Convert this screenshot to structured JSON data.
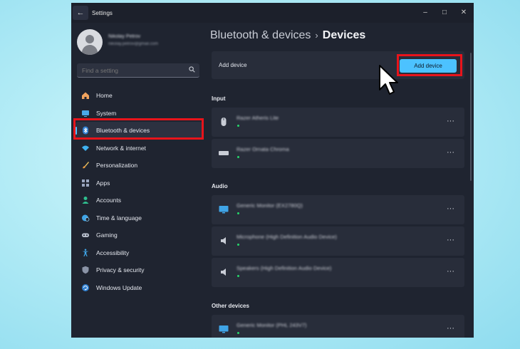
{
  "window": {
    "title": "Settings",
    "controls": {
      "minimize": "–",
      "maximize": "□",
      "close": "✕"
    }
  },
  "profile": {
    "name": "Nikolay Petrov",
    "email": "nikolay.petrov@gmail.com"
  },
  "search": {
    "placeholder": "Find a setting"
  },
  "sidebar": {
    "items": [
      {
        "label": "Home",
        "icon": "home-icon"
      },
      {
        "label": "System",
        "icon": "monitor-icon"
      },
      {
        "label": "Bluetooth & devices",
        "icon": "bluetooth-icon",
        "active": true
      },
      {
        "label": "Network & internet",
        "icon": "wifi-icon"
      },
      {
        "label": "Personalization",
        "icon": "brush-icon"
      },
      {
        "label": "Apps",
        "icon": "apps-icon"
      },
      {
        "label": "Accounts",
        "icon": "person-icon"
      },
      {
        "label": "Time & language",
        "icon": "globe-clock-icon"
      },
      {
        "label": "Gaming",
        "icon": "gamepad-icon"
      },
      {
        "label": "Accessibility",
        "icon": "accessibility-icon"
      },
      {
        "label": "Privacy & security",
        "icon": "shield-icon"
      },
      {
        "label": "Windows Update",
        "icon": "update-icon"
      }
    ]
  },
  "breadcrumb": {
    "parent": "Bluetooth & devices",
    "separator": "›",
    "current": "Devices"
  },
  "add_device": {
    "label": "Add device",
    "button_label": "Add device"
  },
  "sections": {
    "input": {
      "title": "Input",
      "devices": [
        {
          "name": "Razer Atheris Lite",
          "icon": "mouse-icon"
        },
        {
          "name": "Razer Ornata Chroma",
          "icon": "keyboard-icon"
        }
      ]
    },
    "audio": {
      "title": "Audio",
      "devices": [
        {
          "name": "Generic Monitor (EX2780Q)",
          "icon": "monitor-icon"
        },
        {
          "name": "Microphone (High Definition Audio Device)",
          "icon": "speaker-icon"
        },
        {
          "name": "Speakers (High Definition Audio Device)",
          "icon": "speaker-icon"
        }
      ]
    },
    "other": {
      "title": "Other devices",
      "devices": [
        {
          "name": "Generic Monitor (PHL 243V7)",
          "icon": "monitor-icon"
        }
      ]
    }
  },
  "more_label": "···",
  "colors": {
    "accent": "#4cc2ff",
    "highlight": "#e8141b",
    "status_dot": "#27d36a",
    "background": "#1f2430"
  }
}
